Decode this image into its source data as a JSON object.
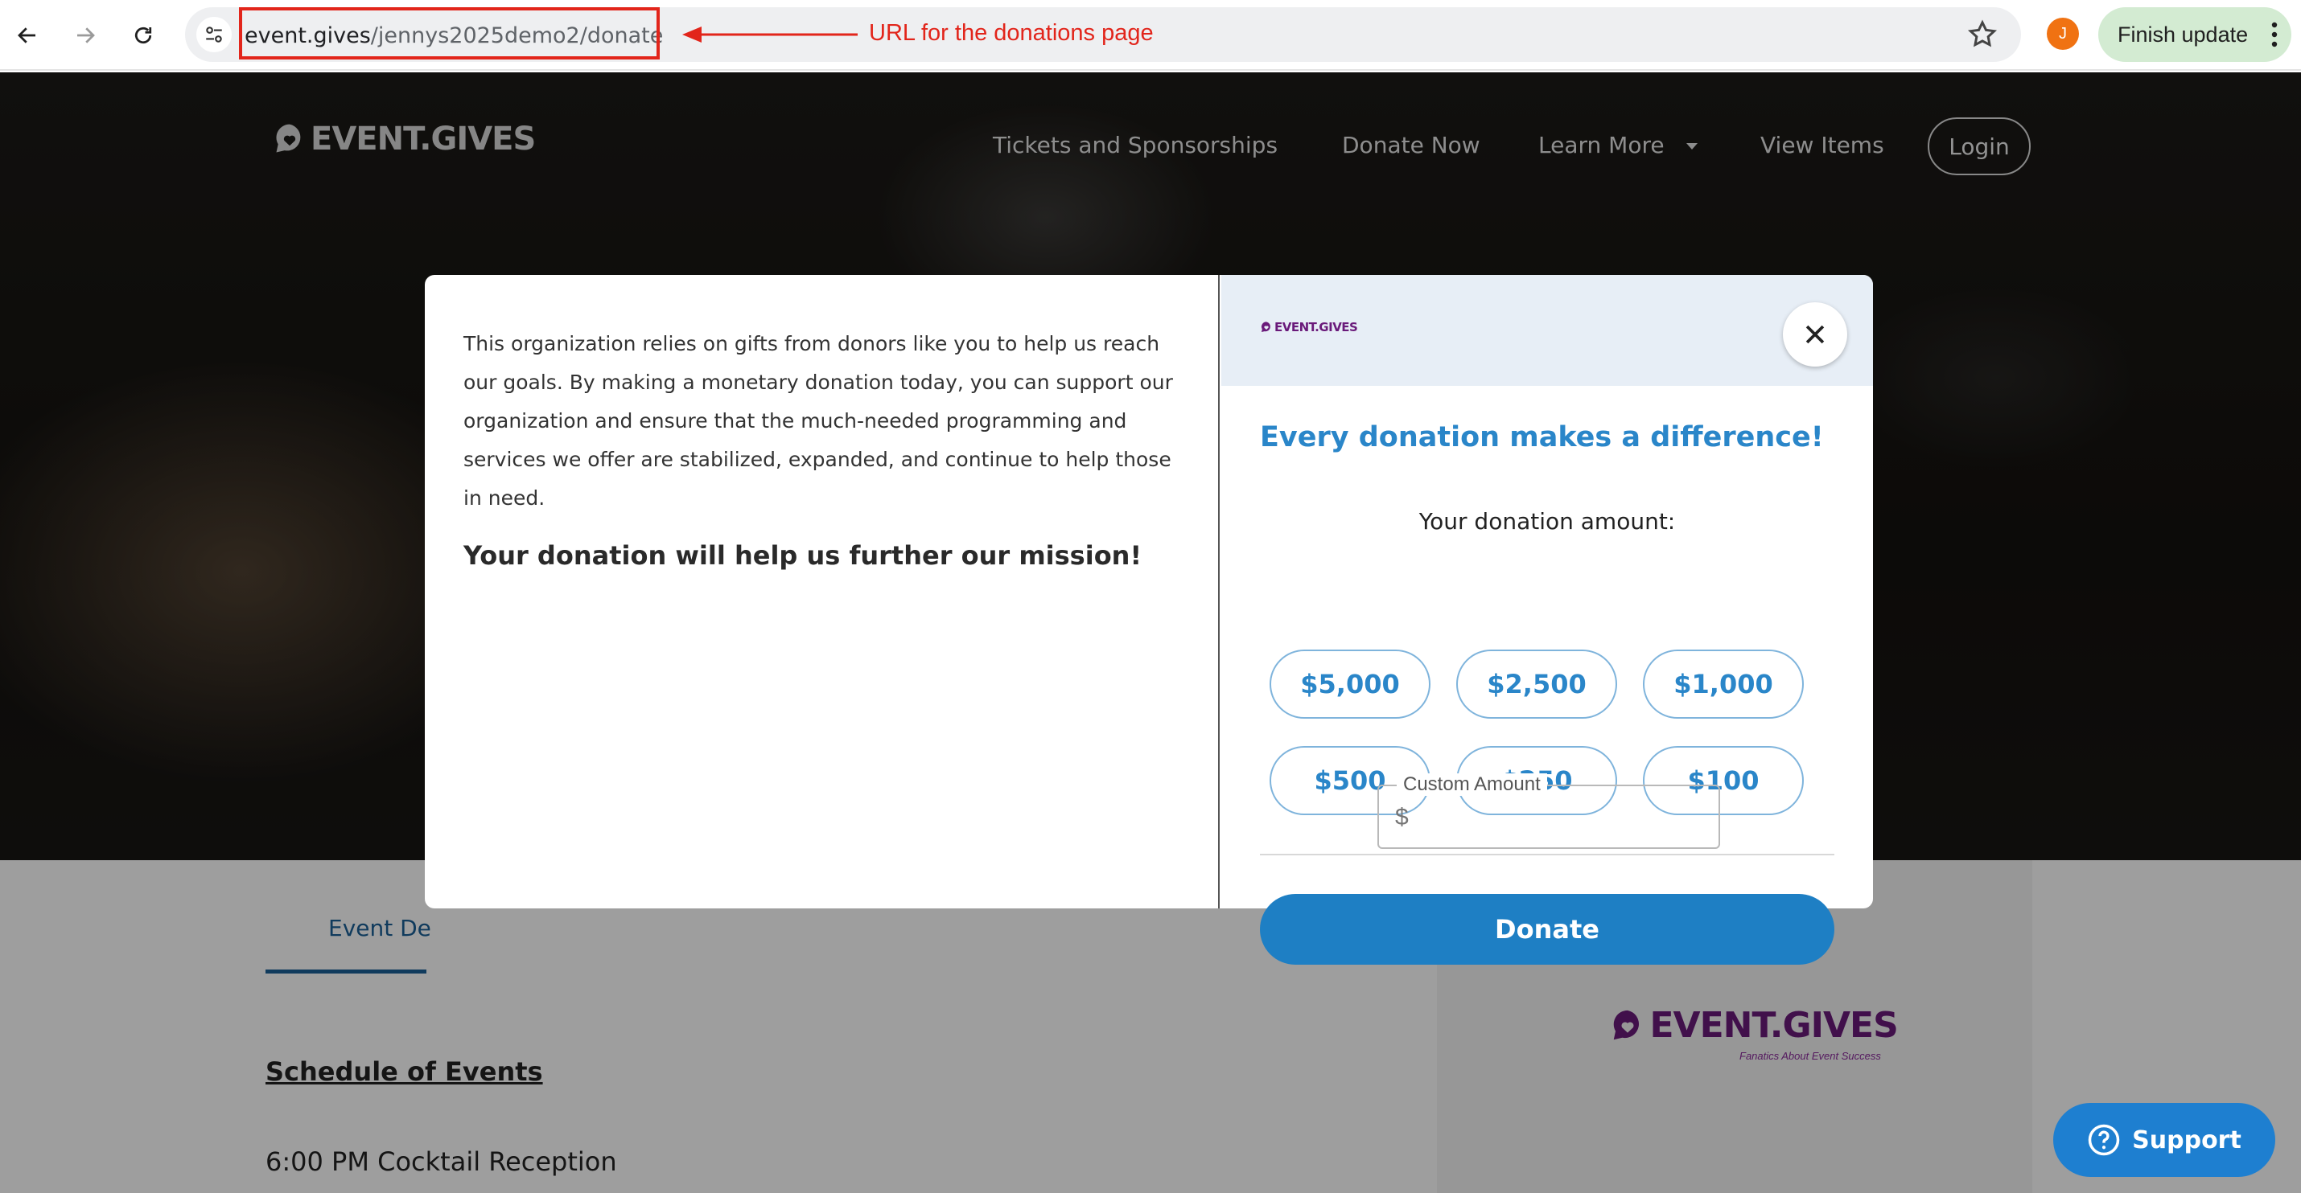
{
  "browser": {
    "url_domain": "event.gives",
    "url_path": "/jennys2025demo2/donate",
    "annotation": "URL for the donations page",
    "profile_initial": "J",
    "finish_update_label": "Finish update",
    "colors": {
      "annotation": "#e2251b",
      "update_bg": "#d3ebd2",
      "profile": "#f07212"
    }
  },
  "site": {
    "logo_text": "EVENT.GIVES",
    "nav": {
      "tickets": "Tickets and Sponsorships",
      "donate": "Donate Now",
      "learn_more": "Learn More",
      "view_items": "View Items",
      "login": "Login"
    },
    "tab_label": "Event De",
    "schedule_title": "Schedule of Events",
    "schedule_item": "6:00 PM Cocktail Reception",
    "sidebar_logo_text": "EVENT.GIVES",
    "sidebar_logo_tagline": "Fanatics About Event Success"
  },
  "modal": {
    "description": "This organization relies on gifts from donors like you to help us reach our goals. By making a monetary donation today, you can support our organization and ensure that the much-needed programming and services we offer are stabilized, expanded, and continue to help those in need.",
    "mission": "Your donation will help us further our mission!",
    "mini_logo_text": "EVENT.GIVES",
    "heading": "Every donation makes a difference!",
    "amount_label": "Your donation amount:",
    "amounts": [
      "$5,000",
      "$2,500",
      "$1,000",
      "$500",
      "$250",
      "$100"
    ],
    "custom_label": "Custom Amount",
    "custom_placeholder": "$",
    "donate_label": "Donate",
    "colors": {
      "accent": "#2a86c9",
      "button": "#1e7fc4",
      "header_bg": "#e7eef6"
    }
  },
  "support": {
    "label": "Support"
  }
}
